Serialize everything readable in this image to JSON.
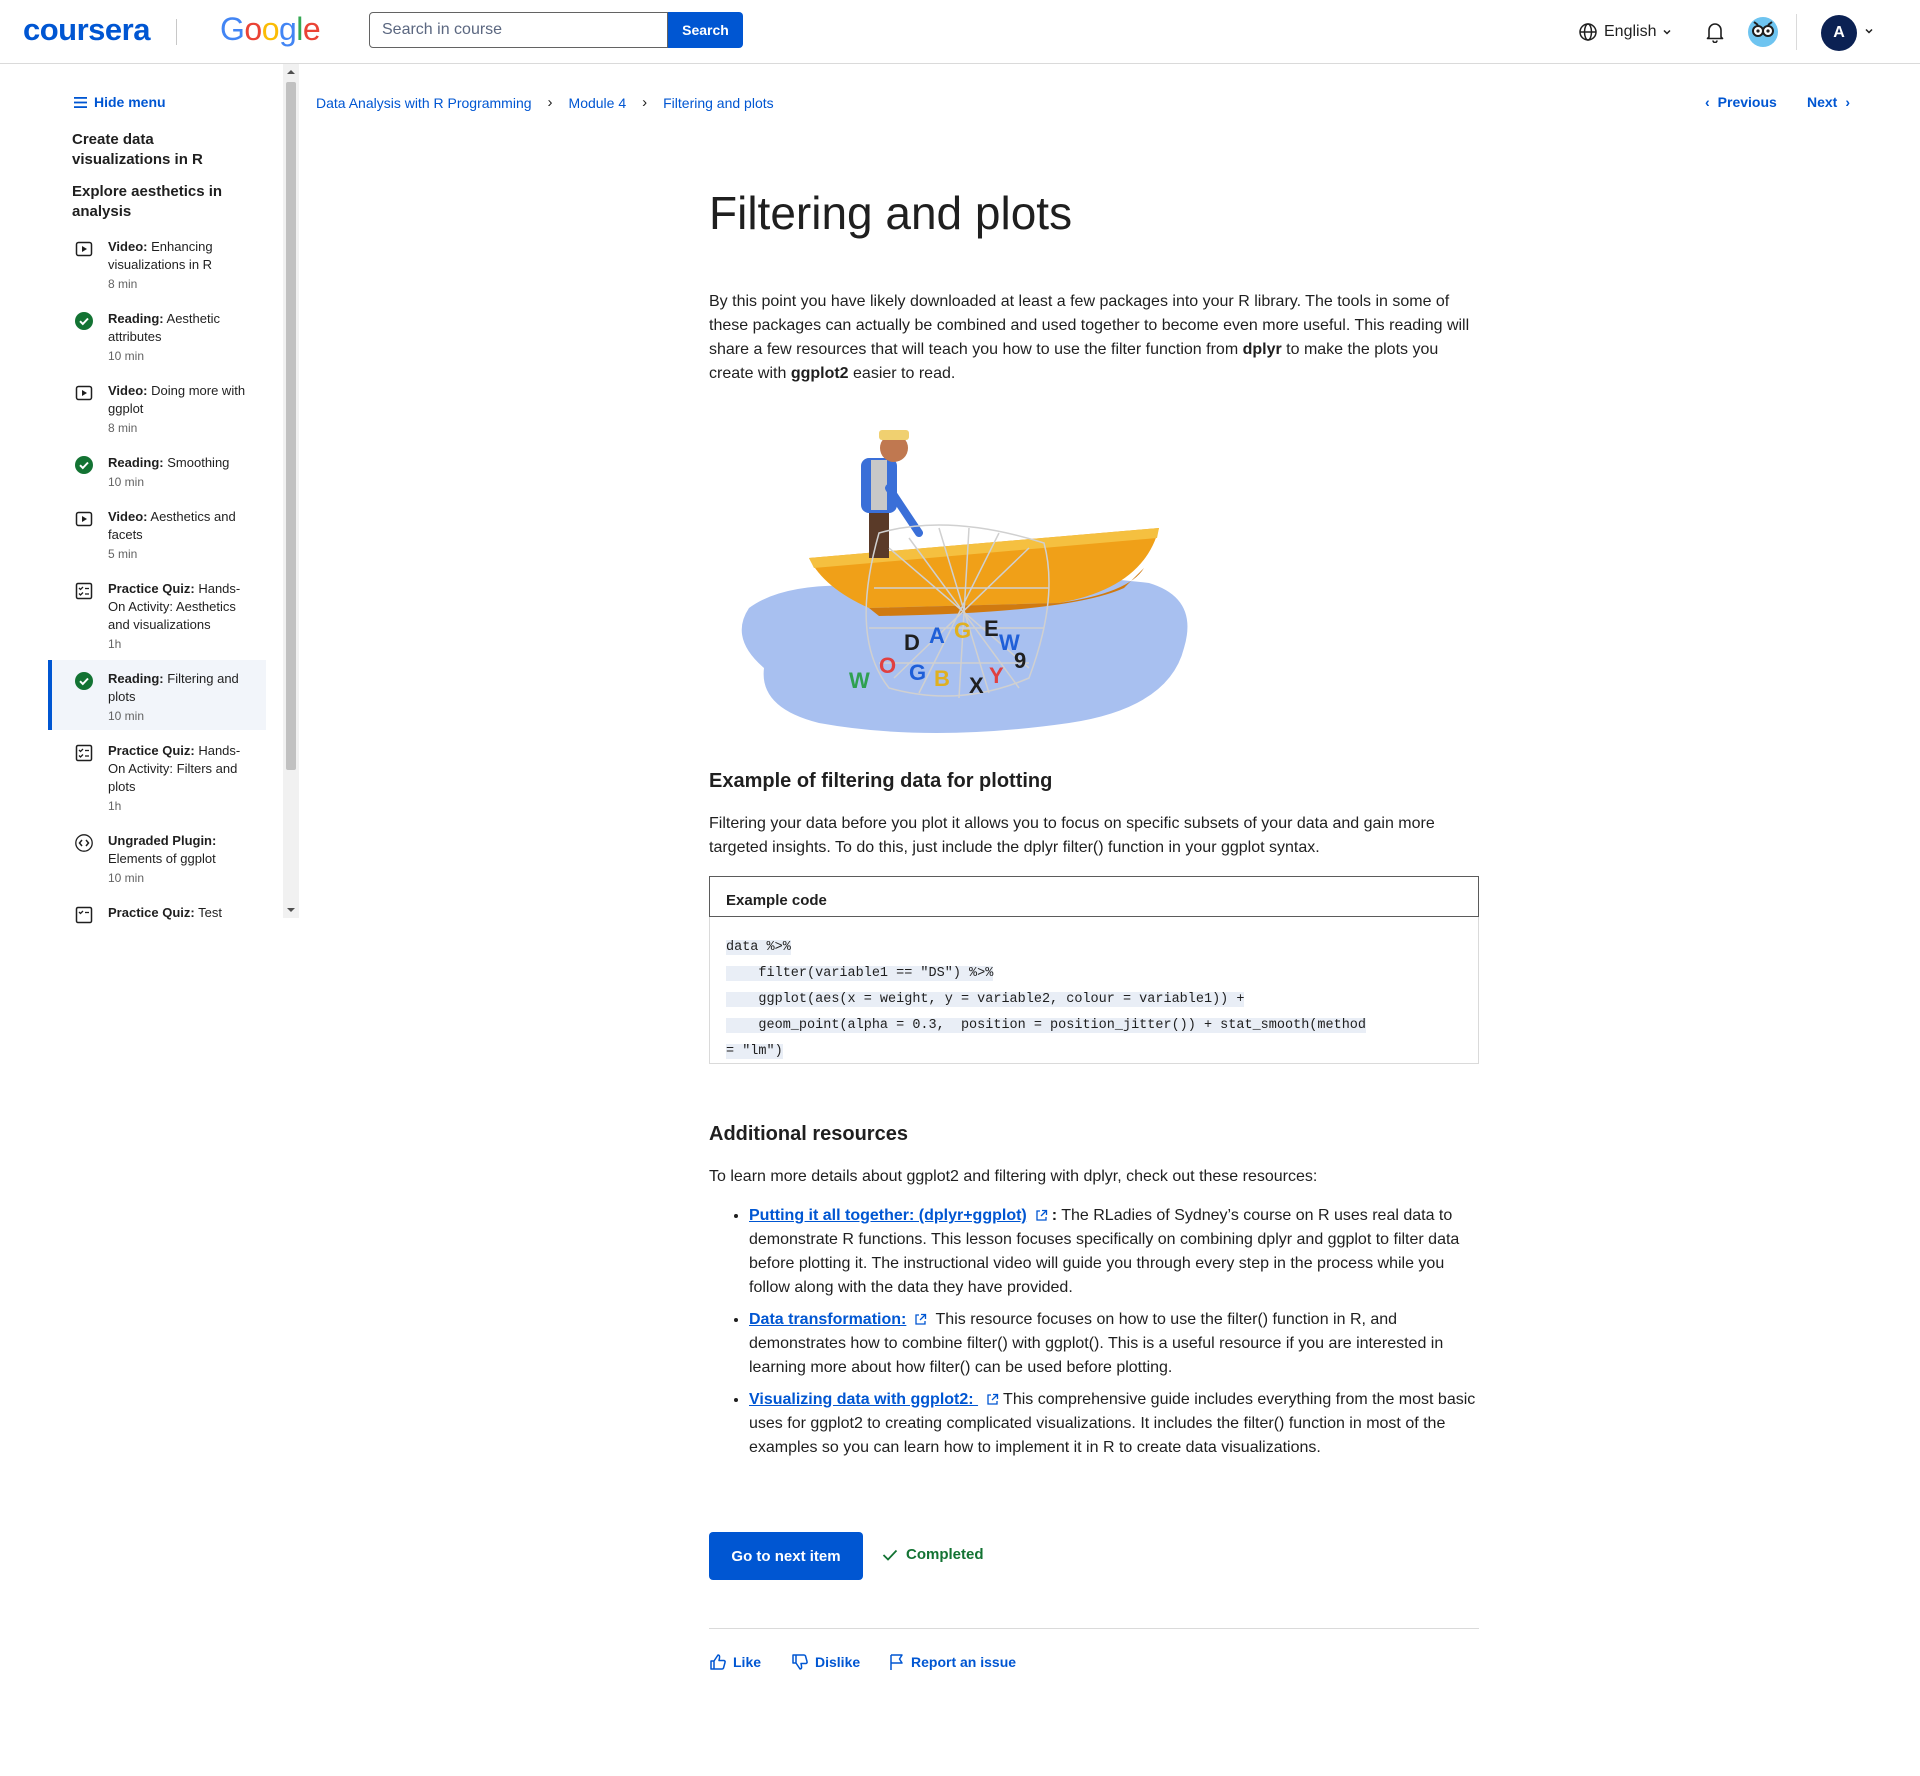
{
  "header": {
    "brand": "coursera",
    "partner": "Google",
    "search_placeholder": "Search in course",
    "search_button": "Search",
    "language": "English",
    "avatar_initial": "A"
  },
  "sidebar": {
    "hide_menu": "Hide menu",
    "section_title_1": "Create data visualizations in R",
    "section_title_2": "Explore aesthetics in analysis",
    "items": [
      {
        "type": "Video:",
        "title": "Enhancing visualizations in R",
        "time": "8 min",
        "icon": "play-icon"
      },
      {
        "type": "Reading:",
        "title": "Aesthetic attributes",
        "time": "10 min",
        "icon": "check-circle-icon"
      },
      {
        "type": "Video:",
        "title": "Doing more with ggplot",
        "time": "8 min",
        "icon": "play-icon"
      },
      {
        "type": "Reading:",
        "title": "Smoothing",
        "time": "10 min",
        "icon": "check-circle-icon"
      },
      {
        "type": "Video:",
        "title": "Aesthetics and facets",
        "time": "5 min",
        "icon": "play-icon"
      },
      {
        "type": "Practice Quiz:",
        "title": "Hands-On Activity: Aesthetics and visualizations",
        "time": "1h",
        "icon": "quiz-icon"
      },
      {
        "type": "Reading:",
        "title": "Filtering and plots",
        "time": "10 min",
        "icon": "check-circle-icon"
      },
      {
        "type": "Practice Quiz:",
        "title": "Hands-On Activity: Filters and plots",
        "time": "1h",
        "icon": "quiz-icon"
      },
      {
        "type": "Ungraded Plugin:",
        "title": "Elements of ggplot",
        "time": "10 min",
        "icon": "code-icon"
      },
      {
        "type": "Practice Quiz:",
        "title": "Test",
        "time": "",
        "icon": "quiz-icon"
      }
    ]
  },
  "breadcrumb": [
    "Data Analysis with R Programming",
    "Module 4",
    "Filtering and plots"
  ],
  "nav": {
    "previous": "Previous",
    "next": "Next"
  },
  "page": {
    "title": "Filtering and plots",
    "intro_1": "By this point you have likely downloaded at least a few packages into your R library. The tools in some of these packages can actually be combined and used together to become even more useful. This reading will share a few resources that will teach you how to use the filter function from ",
    "intro_dplyr": "dplyr",
    "intro_2": " to make the plots you create with ",
    "intro_ggplot2": "ggplot2",
    "intro_3": " easier to read.",
    "example_heading": "Example of filtering data for plotting",
    "example_text": "Filtering your data before you plot it allows you to focus on specific subsets of your data and gain more targeted insights. To do this, just include the dplyr filter() function in your ggplot syntax.",
    "code_label": "Example code",
    "code_lines": [
      "data %>%",
      "    filter(variable1 == \"DS\") %>%",
      "    ggplot(aes(x = weight, y = variable2, colour = variable1)) +",
      "    geom_point(alpha = 0.3,  position = position_jitter()) + stat_smooth(method",
      "= \"lm\")"
    ],
    "resources_heading": "Additional resources",
    "resources_intro": "To learn more details about ggplot2 and filtering with dplyr, check out these resources:",
    "resources": [
      {
        "link": "Putting it all together: (dplyr+ggplot)",
        "colon": ":",
        "text": " The RLadies of Sydney’s course on R uses real data to demonstrate R functions. This lesson focuses specifically on combining dplyr and ggplot to filter data before plotting it. The instructional video will guide you through every step in the process while you follow along with the data they have provided."
      },
      {
        "link": "Data transformation:",
        "colon": "",
        "text": " This resource focuses on how to use the filter() function in R, and demonstrates how to combine filter() with ggplot(). This is a useful resource if you are interested in learning more about how filter() can be used before plotting."
      },
      {
        "link": "Visualizing data with ggplot2: ",
        "colon": "",
        "text": "This comprehensive guide includes everything from the most basic uses for ggplot2 to creating complicated visualizations. It includes the filter() function in most of the examples so you can learn how to implement it in R to create data visualizations."
      }
    ],
    "next_item_button": "Go to next item",
    "completed_label": "Completed",
    "like": "Like",
    "dislike": "Dislike",
    "report": "Report an issue"
  }
}
